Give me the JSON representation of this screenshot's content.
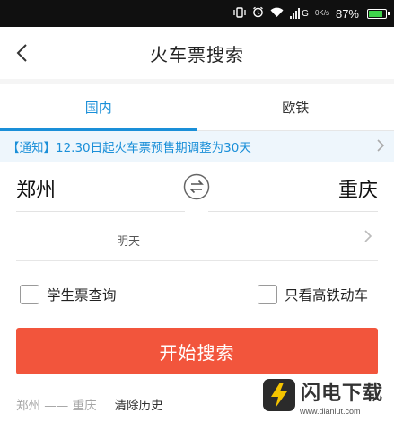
{
  "status_bar": {
    "battery_percent": "87%",
    "network_label": "G",
    "speed_label": "0K/s",
    "icons": [
      "vibrate-icon",
      "alarm-icon",
      "wifi-icon",
      "signal-icon",
      "battery-icon"
    ]
  },
  "nav": {
    "back_icon": "chevron-left-icon",
    "title": "火车票搜索"
  },
  "tabs": [
    {
      "label": "国内",
      "active": true
    },
    {
      "label": "欧铁",
      "active": false
    }
  ],
  "notice": {
    "text": "【通知】12.30日起火车票预售期调整为30天",
    "chevron_icon": "chevron-right-icon"
  },
  "route": {
    "from": "郑州",
    "to": "重庆",
    "swap_icon": "swap-icon"
  },
  "date": {
    "label": "明天",
    "chevron_icon": "chevron-right-icon"
  },
  "options": {
    "student_label": "学生票查询",
    "high_speed_label": "只看高铁动车",
    "student_checked": false,
    "high_speed_checked": false
  },
  "search_button": {
    "label": "开始搜索"
  },
  "history": {
    "item": "郑州 —— 重庆",
    "clear_label": "清除历史"
  },
  "watermark": {
    "name": "闪电下载",
    "url": "www.dianlut.com"
  },
  "colors": {
    "accent_blue": "#1a8fd8",
    "button_red": "#f2553c",
    "notice_bg": "#eef6fc"
  }
}
